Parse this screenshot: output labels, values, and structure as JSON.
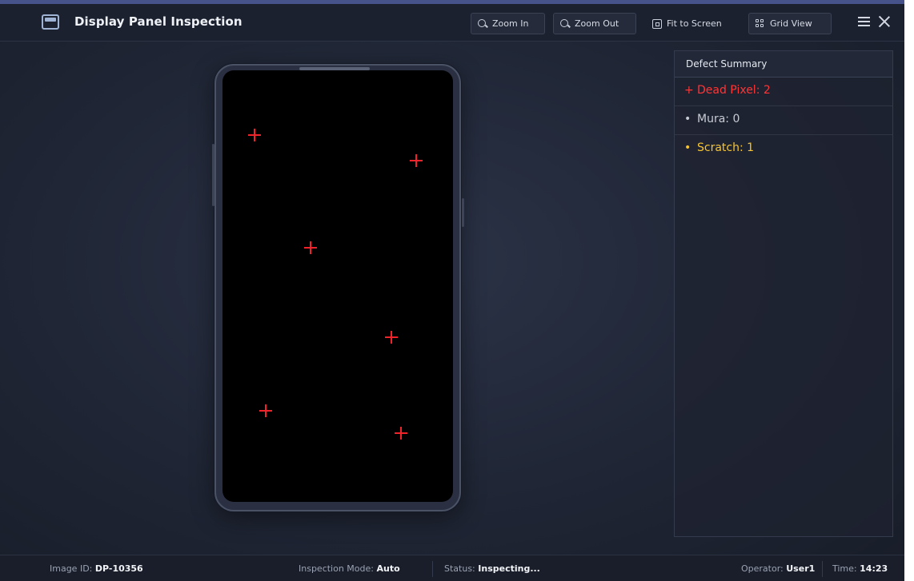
{
  "app": {
    "title": "Display Panel Inspection"
  },
  "toolbar": {
    "zoom_in": "Zoom In",
    "zoom_out": "Zoom Out",
    "fit_to_screen": "Fit to Screen",
    "grid_view": "Grid View"
  },
  "viewer": {
    "marker_color": "#f0232a"
  },
  "defect_summary": {
    "title": "Defect Summary",
    "items": [
      {
        "bullet": "+",
        "label": "Dead Pixel: 2",
        "color": "#ff3535"
      },
      {
        "bullet": "•",
        "label": "Mura: 0",
        "color": "#c7cbd3"
      },
      {
        "bullet": "•",
        "label": "Scratch: 1",
        "color": "#f7c531"
      }
    ]
  },
  "status_bar": {
    "image_id_label": "Image ID:",
    "image_id": "DP-10356",
    "mode_label": "Inspection Mode:",
    "mode": "Auto",
    "status_label": "Status:",
    "status": "Inspecting...",
    "operator_label": "Operator:",
    "operator": "User1",
    "time_label": "Time:",
    "time": "14:23"
  }
}
